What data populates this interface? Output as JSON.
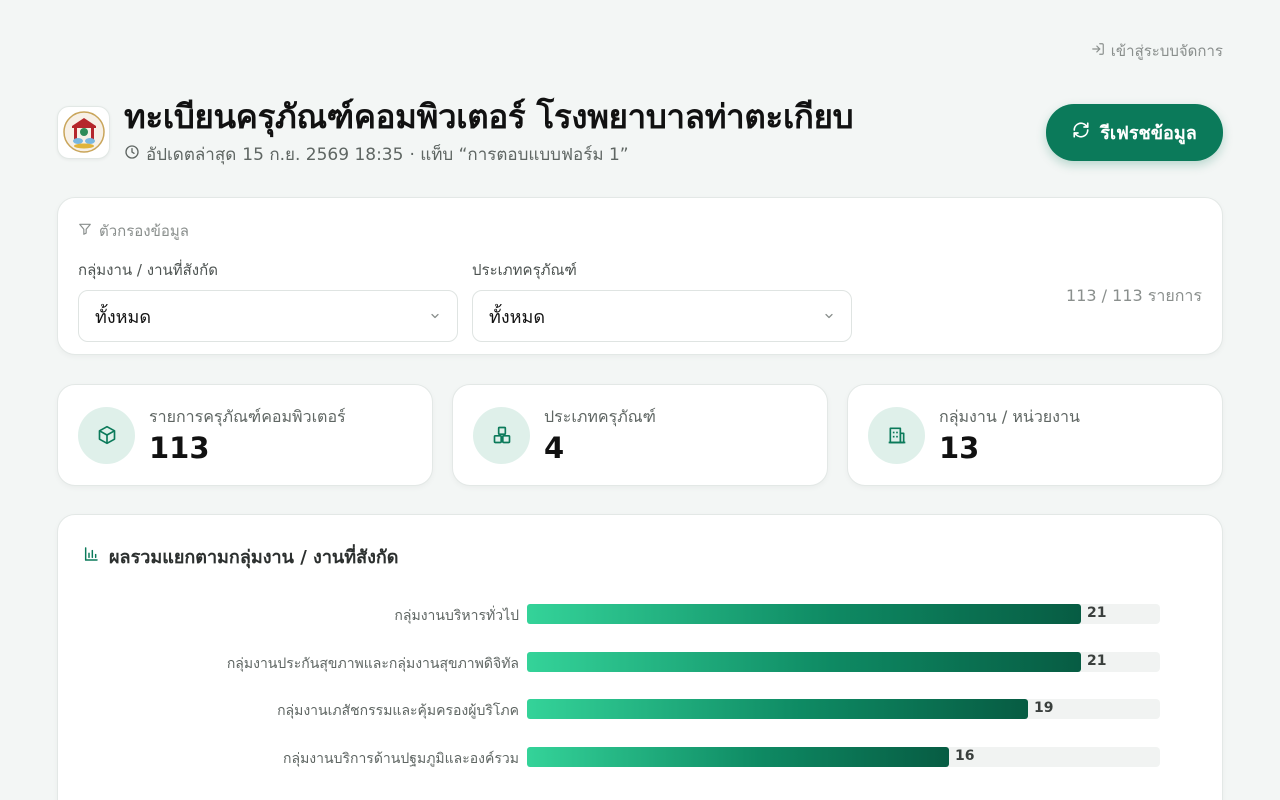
{
  "header": {
    "login_label": "เข้าสู่ระบบจัดการ",
    "title": "ทะเบียนครุภัณฑ์คอมพิวเตอร์ โรงพยาบาลท่าตะเกียบ",
    "updated_label": "อัปเดตล่าสุด",
    "updated_time": "15 ก.ย. 2569 18:35",
    "tab_label": "· แท็บ “การตอบแบบฟอร์ม 1”",
    "refresh_label": "รีเฟรชข้อมูล"
  },
  "filters": {
    "heading": "ตัวกรองข้อมูล",
    "group_label": "กลุ่มงาน / งานที่สังกัด",
    "group_value": "ทั้งหมด",
    "type_label": "ประเภทครุภัณฑ์",
    "type_value": "ทั้งหมด",
    "count_text": "113 / 113 รายการ"
  },
  "stats": [
    {
      "label": "รายการครุภัณฑ์คอมพิวเตอร์",
      "value": "113",
      "icon": "box-icon"
    },
    {
      "label": "ประเภทครุภัณฑ์",
      "value": "4",
      "icon": "boxes-icon"
    },
    {
      "label": "กลุ่มงาน / หน่วยงาน",
      "value": "13",
      "icon": "building-icon"
    }
  ],
  "chart_title": "ผลรวมแยกตามกลุ่มงาน / งานที่สังกัด",
  "chart_data": {
    "type": "bar",
    "orientation": "horizontal",
    "categories": [
      "กลุ่มงานบริหารทั่วไป",
      "กลุ่มงานประกันสุขภาพและกลุ่มงานสุขภาพดิจิทัล",
      "กลุ่มงานเภสัชกรรมและคุ้มครองผู้บริโภค",
      "กลุ่มงานบริการด้านปฐมภูมิและองค์รวม"
    ],
    "values": [
      21,
      21,
      19,
      16
    ],
    "xlim": [
      0,
      24
    ],
    "colors": {
      "start": "#34d399",
      "end": "#075c43"
    }
  }
}
